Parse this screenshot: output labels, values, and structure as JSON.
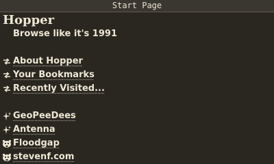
{
  "window": {
    "title": "Start Page"
  },
  "page": {
    "title": "Hopper",
    "subtitle": "Browse like it's 1991"
  },
  "menu_links": [
    {
      "label": "About Hopper",
      "icon": "arrow-right-icon"
    },
    {
      "label": "Your Bookmarks",
      "icon": "arrow-right-icon"
    },
    {
      "label": "Recently Visited...",
      "icon": "arrow-right-icon"
    }
  ],
  "external_links": [
    {
      "label": "GeoPeeDees",
      "icon": "sparkle-icon"
    },
    {
      "label": "Antenna",
      "icon": "sparkle-icon"
    },
    {
      "label": "Floodgap",
      "icon": "gopher-icon"
    },
    {
      "label": "stevenf.com",
      "icon": "gopher-icon"
    }
  ],
  "colors": {
    "background": "#2a2721",
    "titlebar": "#3a3630",
    "text": "#ece6d3"
  }
}
